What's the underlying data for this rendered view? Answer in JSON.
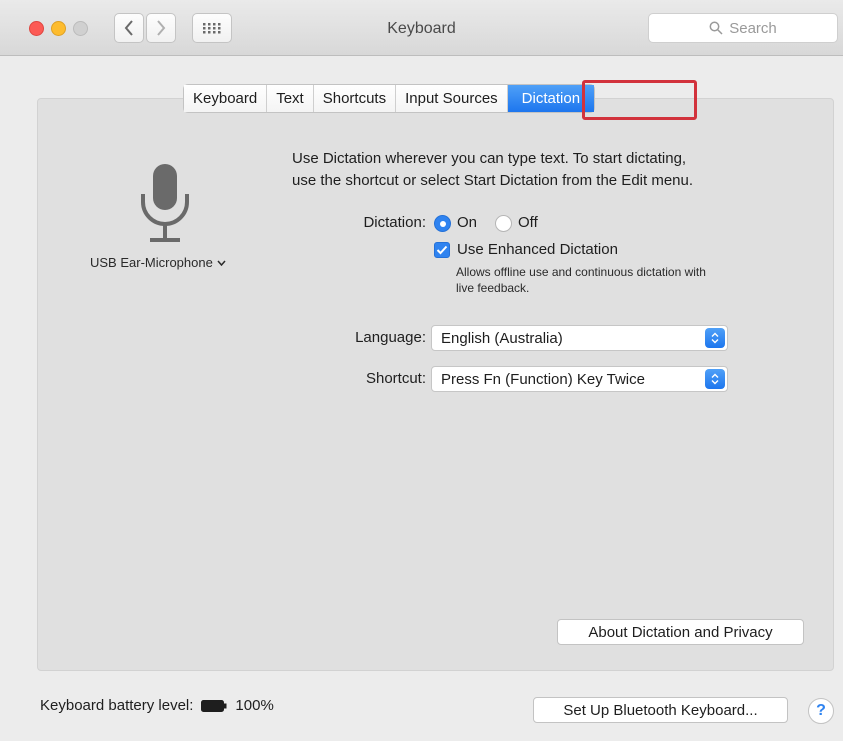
{
  "window": {
    "title": "Keyboard",
    "search_placeholder": "Search"
  },
  "tabs": [
    "Keyboard",
    "Text",
    "Shortcuts",
    "Input Sources",
    "Dictation"
  ],
  "selected_tab": "Dictation",
  "microphone": {
    "label": "USB Ear-Microphone"
  },
  "intro": {
    "line1": "Use Dictation wherever you can type text. To start dictating,",
    "line2": "use the shortcut or select Start Dictation from the Edit menu."
  },
  "dictation": {
    "label": "Dictation:",
    "on_label": "On",
    "off_label": "Off",
    "value": "On",
    "enhanced_label": "Use Enhanced Dictation",
    "enhanced_checked": true,
    "enhanced_desc_line1": "Allows offline use and continuous dictation with",
    "enhanced_desc_line2": "live feedback."
  },
  "language": {
    "label": "Language:",
    "value": "English (Australia)"
  },
  "shortcut": {
    "label": "Shortcut:",
    "value": "Press Fn (Function) Key Twice"
  },
  "buttons": {
    "about": "About Dictation and Privacy",
    "bluetooth": "Set Up Bluetooth Keyboard...",
    "help": "?"
  },
  "battery": {
    "label": "Keyboard battery level:",
    "value": "100%"
  },
  "colors": {
    "accent": "#2f83f0",
    "highlight_outline": "#d2323c"
  }
}
